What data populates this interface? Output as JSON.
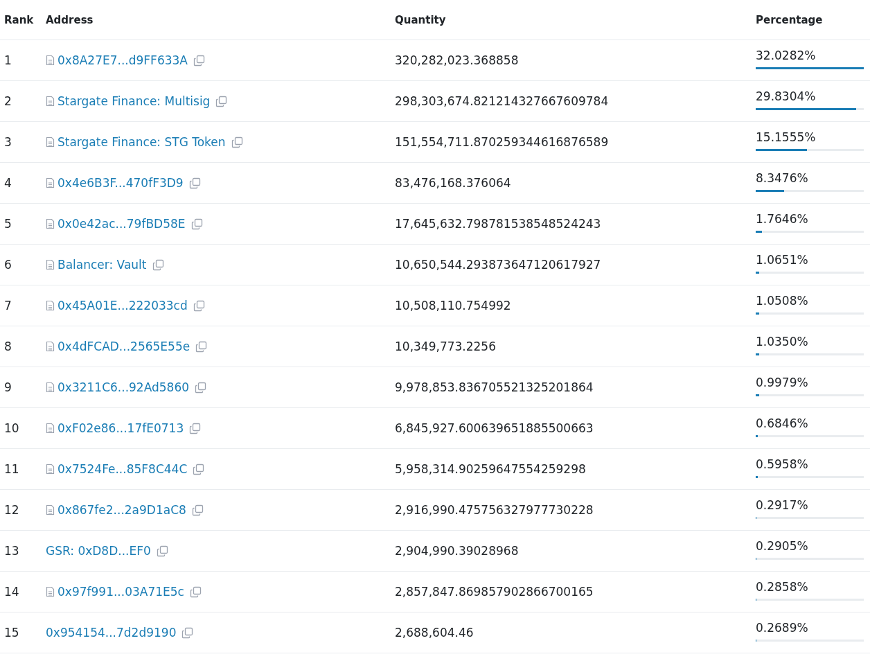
{
  "table": {
    "columns": [
      "Rank",
      "Address",
      "Quantity",
      "Percentage"
    ],
    "rows": [
      {
        "rank": "1",
        "address": "0x8A27E7...d9FF633A",
        "contract": true,
        "quantity": "320,282,023.368858",
        "percentage": "32.0282%",
        "level": 1.0
      },
      {
        "rank": "2",
        "address": "Stargate Finance: Multisig",
        "contract": true,
        "quantity": "298,303,674.821214327667609784",
        "percentage": "29.8304%",
        "level": 0.931
      },
      {
        "rank": "3",
        "address": "Stargate Finance: STG Token",
        "contract": true,
        "quantity": "151,554,711.870259344616876589",
        "percentage": "15.1555%",
        "level": 0.473
      },
      {
        "rank": "4",
        "address": "0x4e6B3F...470fF3D9",
        "contract": true,
        "quantity": "83,476,168.376064",
        "percentage": "8.3476%",
        "level": 0.261
      },
      {
        "rank": "5",
        "address": "0x0e42ac...79fBD58E",
        "contract": true,
        "quantity": "17,645,632.798781538548524243",
        "percentage": "1.7646%",
        "level": 0.055
      },
      {
        "rank": "6",
        "address": "Balancer: Vault",
        "contract": true,
        "quantity": "10,650,544.293873647120617927",
        "percentage": "1.0651%",
        "level": 0.033
      },
      {
        "rank": "7",
        "address": "0x45A01E...222033cd",
        "contract": true,
        "quantity": "10,508,110.754992",
        "percentage": "1.0508%",
        "level": 0.033
      },
      {
        "rank": "8",
        "address": "0x4dFCAD...2565E55e",
        "contract": true,
        "quantity": "10,349,773.2256",
        "percentage": "1.0350%",
        "level": 0.032
      },
      {
        "rank": "9",
        "address": "0x3211C6...92Ad5860",
        "contract": true,
        "quantity": "9,978,853.836705521325201864",
        "percentage": "0.9979%",
        "level": 0.031
      },
      {
        "rank": "10",
        "address": "0xF02e86...17fE0713",
        "contract": true,
        "quantity": "6,845,927.600639651885500663",
        "percentage": "0.6846%",
        "level": 0.021
      },
      {
        "rank": "11",
        "address": "0x7524Fe...85F8C44C",
        "contract": true,
        "quantity": "5,958,314.90259647554259298",
        "percentage": "0.5958%",
        "level": 0.019
      },
      {
        "rank": "12",
        "address": "0x867fe2...2a9D1aC8",
        "contract": true,
        "quantity": "2,916,990.475756327977730228",
        "percentage": "0.2917%",
        "level": 0.009
      },
      {
        "rank": "13",
        "address": "GSR: 0xD8D...EF0",
        "contract": false,
        "quantity": "2,904,990.39028968",
        "percentage": "0.2905%",
        "level": 0.009
      },
      {
        "rank": "14",
        "address": "0x97f991...03A71E5c",
        "contract": true,
        "quantity": "2,857,847.869857902866700165",
        "percentage": "0.2858%",
        "level": 0.009
      },
      {
        "rank": "15",
        "address": "0x954154...7d2d9190",
        "contract": false,
        "quantity": "2,688,604.46",
        "percentage": "0.2689%",
        "level": 0.008
      }
    ]
  }
}
